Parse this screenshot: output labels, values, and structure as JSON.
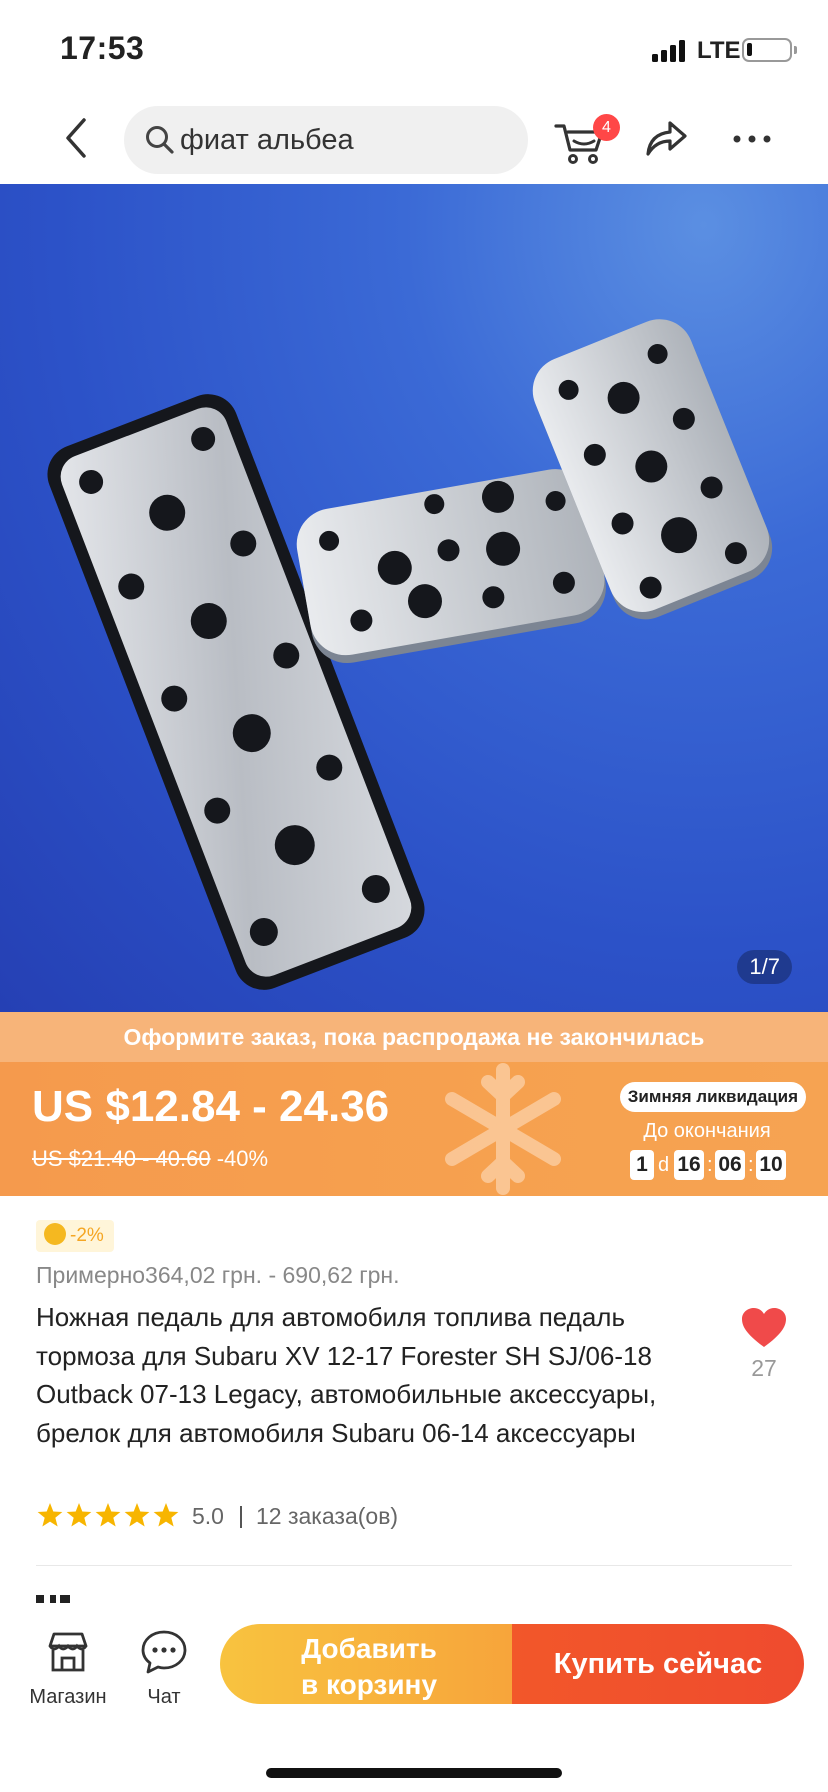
{
  "status_bar": {
    "time": "17:53",
    "network": "LTE",
    "battery_level": 0.12
  },
  "top_nav": {
    "search_value": "фиат альбеа",
    "cart_count": "4",
    "icons": [
      "back-icon",
      "search-icon",
      "cart-icon",
      "share-icon",
      "more-icon"
    ]
  },
  "gallery": {
    "counter": "1/7"
  },
  "promo": {
    "banner_text": "Оформите заказ, пока распродажа не закончилась",
    "price_range": "US $12.84 - 24.36",
    "old_price": "US $21.40 - 40.60",
    "discount": "-40%",
    "sale_badge": "Зимняя ликвидация",
    "until_label": "До окончания",
    "countdown": {
      "days": "1",
      "days_unit": "d",
      "hours": "16",
      "minutes": "06",
      "seconds": "10",
      "sep": ":"
    },
    "colors": {
      "strip": "#f7b479",
      "panel": "#f59a4d"
    }
  },
  "product": {
    "coin_discount": "-2%",
    "approx_price": "Примерно364,02 грн. - 690,62 грн.",
    "title": "Ножная педаль для автомобиля топлива педаль тормоза для Subaru XV 12-17 Forester SH SJ/06-18 Outback 07-13 Legacy, автомобильные аксессуары, брелок для автомобиля Subaru 06-14 аксессуары",
    "wishlist_count": "27",
    "rating": "5.0",
    "stars": 5,
    "orders": "12 заказа(ов)"
  },
  "bottom_bar": {
    "store_label": "Магазин",
    "chat_label": "Чат",
    "add_to_cart_line1": "Добавить",
    "add_to_cart_line2": "в корзину",
    "buy_now": "Купить сейчас",
    "colors": {
      "cart": "#f8b83d",
      "buy": "#f0502c"
    }
  }
}
